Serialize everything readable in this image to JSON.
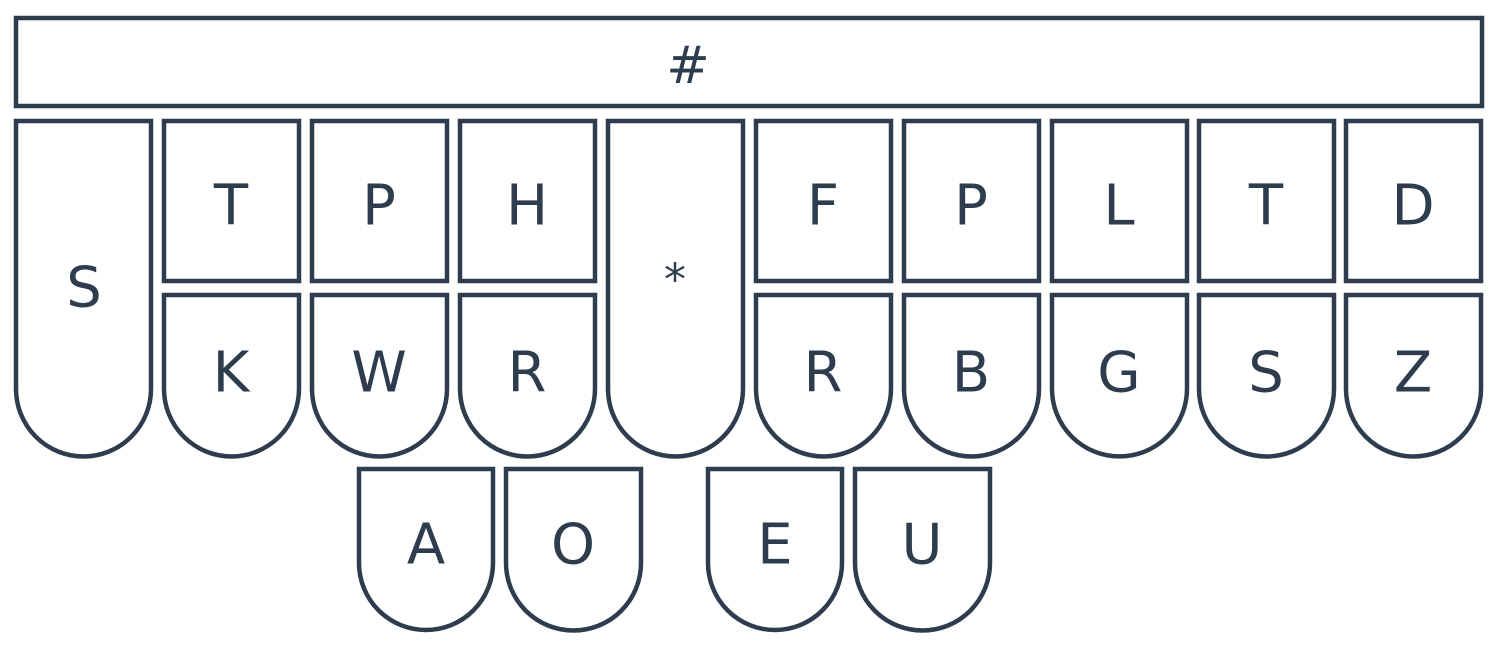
{
  "keyboard": {
    "number_bar": {
      "label": "#"
    },
    "left_s": {
      "label": "S"
    },
    "left_top": [
      "T",
      "P",
      "H"
    ],
    "left_bottom": [
      "K",
      "W",
      "R"
    ],
    "asterisk": {
      "label": "*"
    },
    "right_top": [
      "F",
      "P",
      "L",
      "T",
      "D"
    ],
    "right_bottom": [
      "R",
      "B",
      "G",
      "S",
      "Z"
    ],
    "vowels": [
      "A",
      "O",
      "E",
      "U"
    ]
  },
  "colors": {
    "stroke": "#2e3d4e",
    "fill": "#ffffff",
    "text": "#2e3d4e"
  }
}
